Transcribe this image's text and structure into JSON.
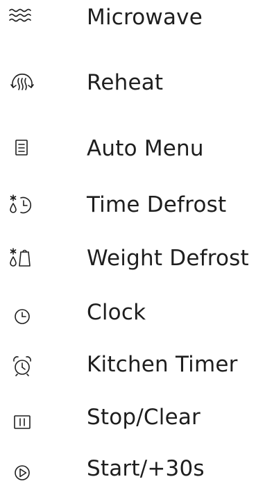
{
  "menu": {
    "items": [
      {
        "label": "Microwave",
        "icon": "microwave-waves-icon"
      },
      {
        "label": "Reheat",
        "icon": "reheat-icon"
      },
      {
        "label": "Auto Menu",
        "icon": "auto-menu-icon"
      },
      {
        "label": "Time Defrost",
        "icon": "time-defrost-icon"
      },
      {
        "label": "Weight Defrost",
        "icon": "weight-defrost-icon"
      },
      {
        "label": "Clock",
        "icon": "clock-icon"
      },
      {
        "label": "Kitchen Timer",
        "icon": "alarm-clock-icon"
      },
      {
        "label": "Stop/Clear",
        "icon": "pause-icon"
      },
      {
        "label": "Start/+30s",
        "icon": "play-icon"
      }
    ]
  },
  "colors": {
    "text": "#1e1e1e",
    "background": "#ffffff"
  }
}
